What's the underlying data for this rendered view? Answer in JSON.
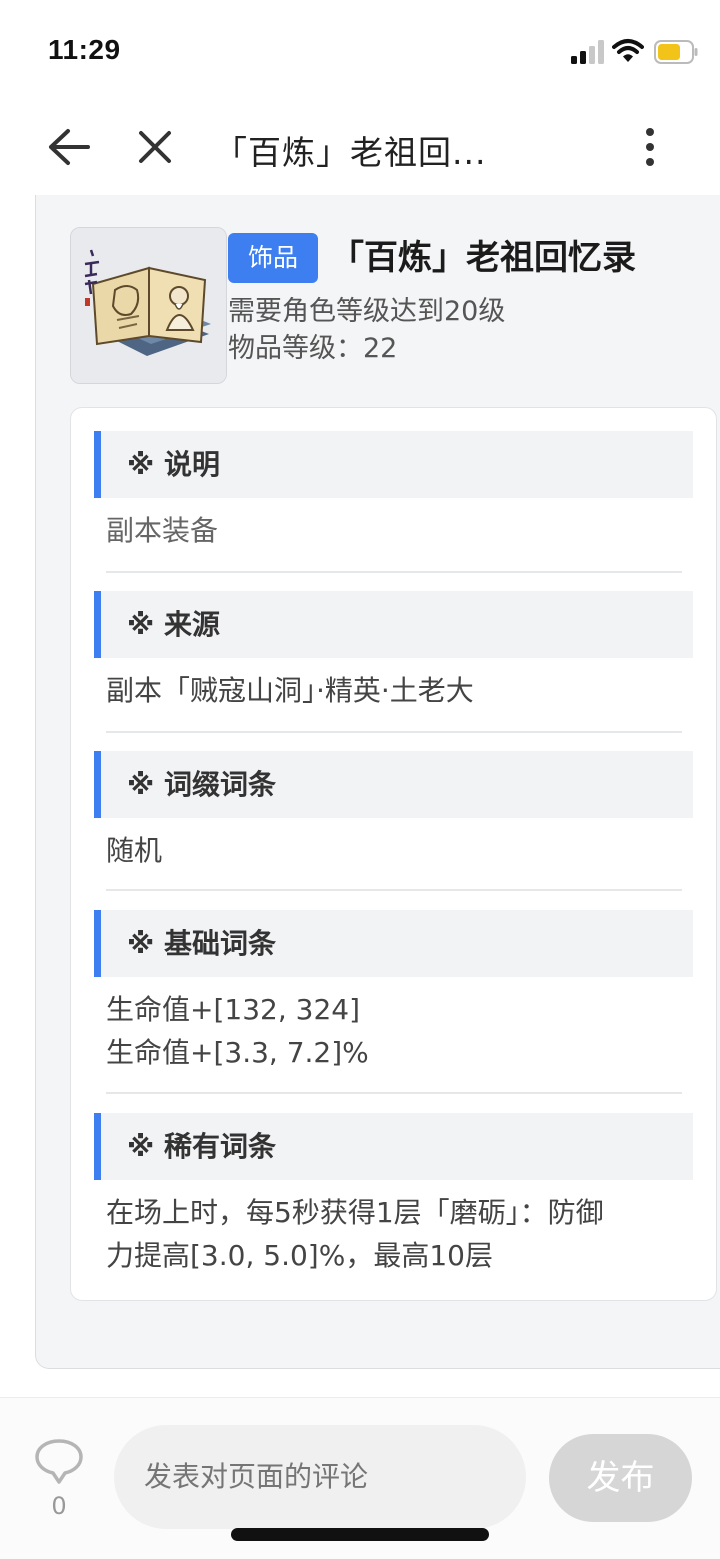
{
  "status_bar": {
    "time": "11:29"
  },
  "nav": {
    "title": "「百炼」老祖回..."
  },
  "item": {
    "tag": "饰品",
    "name": "「百炼」老祖回忆录",
    "requirement": "需要角色等级达到20级",
    "item_level": "物品等级：22",
    "thumbnail_icon": "ancient-book-icon"
  },
  "sections": [
    {
      "title": "※ 说明",
      "lines": [
        "副本装备"
      ]
    },
    {
      "title": "※ 来源",
      "lines": [
        "副本「贼寇山洞」·精英·土老大"
      ]
    },
    {
      "title": "※ 词缀词条",
      "lines": [
        "随机"
      ]
    },
    {
      "title": "※ 基础词条",
      "lines": [
        "生命值+[132, 324]",
        "生命值+[3.3, 7.2]%"
      ]
    },
    {
      "title": "※ 稀有词条",
      "lines": [
        "在场上时，每5秒获得1层「磨砺」：防御",
        "力提高[3.0, 5.0]%，最高10层"
      ]
    }
  ],
  "comment": {
    "count": "0",
    "placeholder": "发表对页面的评论",
    "publish_label": "发布"
  },
  "colors": {
    "accent": "#3d7ff0",
    "tag_text": "#ffffff",
    "disabled_button": "#d6d6d6"
  }
}
